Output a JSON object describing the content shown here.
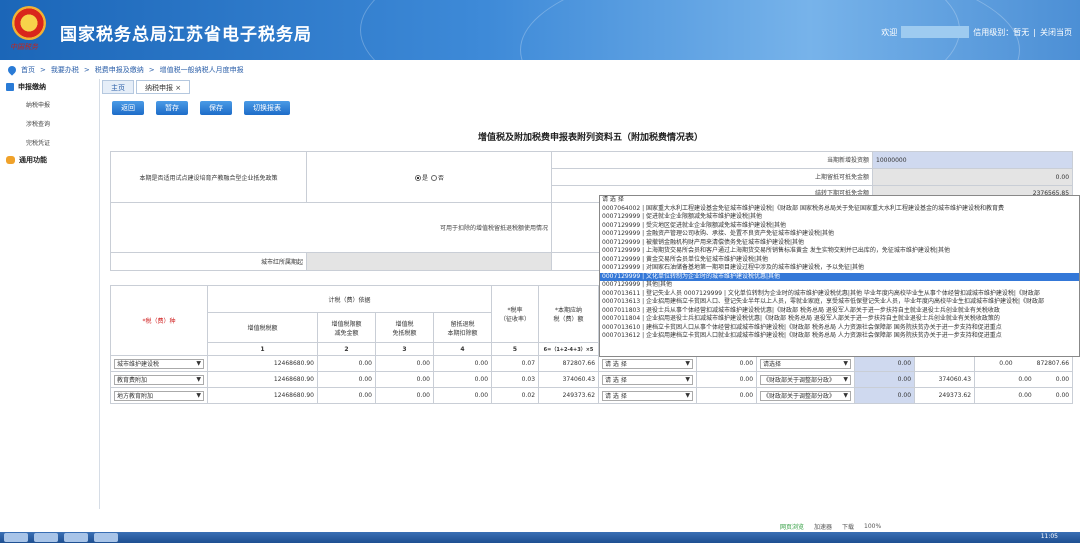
{
  "header": {
    "title": "国家税务总局江苏省电子税务局",
    "emblem_text": "中国税务",
    "welcome": "欢迎",
    "credit": "信用级别：暂无",
    "separator": "|",
    "close": "关闭当页"
  },
  "breadcrumb": [
    "首页",
    ">",
    "我要办税",
    ">",
    "税费申报及缴纳",
    ">",
    "增值税一般纳税人月度申报"
  ],
  "sidebar": {
    "groups": [
      {
        "label": "申报缴纳",
        "items": [
          "纳税申报",
          "涉税查询",
          "完税凭证"
        ]
      },
      {
        "label": "通用功能",
        "items": []
      }
    ]
  },
  "tabs": [
    {
      "label": "主页"
    },
    {
      "label": "纳税申报 ×"
    }
  ],
  "toolbar": {
    "back": "返回",
    "temp_save": "暂存",
    "save": "保存",
    "switch": "切换报表"
  },
  "form_title": "增值税及附加税费申报表附列资料五（附加税费情况表）",
  "top_section": {
    "question": "本期是否适用试点建设培育产教融合型企业抵免政策",
    "yes": "是",
    "no": "否",
    "new_invest_label": "当期新增投资额",
    "new_invest_value": "10000000",
    "prev_deduct_label": "上期留抵可抵免金额",
    "prev_deduct_value": "0.00",
    "carry_label": "结转下期可抵免金额",
    "carry_value": "2376565.85",
    "deduct_label": "可用于扣除的增值税留抵退税额使用情况",
    "bound_label": "城市红所属期起"
  },
  "grid": {
    "tax_type_header": "*税（费）种",
    "basis_header": "计税（费）依据",
    "rate_header": "*税率",
    "rate_sub": "（征收率）",
    "payable_header": "*本期应纳",
    "payable_sub": "税（费）额",
    "cols": [
      "增值税税额",
      "增值税限额",
      "增值税",
      "留抵退税"
    ],
    "cols_sub": [
      "",
      "减免金额",
      "免抵税额",
      "本期扣除额"
    ],
    "nums": [
      "1",
      "2",
      "3",
      "4",
      "5",
      "6=（1+2-4+3）×5"
    ],
    "rows": [
      {
        "type": "城市维护建设税",
        "v1": "12468680.90",
        "v2": "0.00",
        "v3": "0.00",
        "v4": "0.00",
        "rate": "0.07",
        "payable": "872807.66",
        "sel1": "请 选 择",
        "amt1": "0.00",
        "sel2": "请选择",
        "amt2": "0.00",
        "f1": "",
        "f2": "0.00",
        "total": "872807.66"
      },
      {
        "type": "教育费附加",
        "v1": "12468680.90",
        "v2": "0.00",
        "v3": "0.00",
        "v4": "0.00",
        "rate": "0.03",
        "payable": "374060.43",
        "sel1": "请 选 择",
        "amt1": "0.00",
        "sel2": "《财政部关于调整部分政》",
        "amt2": "0.00",
        "f1": "374060.43",
        "f2": "0.00",
        "total": "0.00"
      },
      {
        "type": "地方教育附加",
        "v1": "12468680.90",
        "v2": "0.00",
        "v3": "0.00",
        "v4": "0.00",
        "rate": "0.02",
        "payable": "249373.62",
        "sel1": "请 选 择",
        "amt1": "0.00",
        "sel2": "《财政部关于调整部分政》",
        "amt2": "0.00",
        "f1": "249373.62",
        "f2": "0.00",
        "total": "0.00"
      }
    ]
  },
  "dropdown": {
    "items": [
      "请 选 择",
      "0007064002 | 国家重大水利工程建设基金免征城市维护建设税|《财政部 国家税务总局关于免征国家重大水利工程建设基金的城市维护建设税和教育费",
      "0007129999 | 促进就业企业限额减免城市维护建设税|其他",
      "0007129999 | 受灾地区促进就业企业限额减免城市维护建设税|其他",
      "0007129999 | 金融资产管理公司收购、承接、处置不良资产免征城市维护建设税|其他",
      "0007129999 | 被撤销金融机构财产用来清偿债务免征城市维护建设税|其他",
      "0007129999 | 上海期货交易所会员和客户通过上海期货交易所销售标准黄金 发生实物交割并已出库的，免征城市维护建设税|其他",
      "0007129999 | 黄金交易所会员单位免征城市维护建设税|其他",
      "0007129999 | 对国家石油储备基地第一期项目建设过程中涉及的城市维护建设税，予以免征|其他",
      "0007129999 | 文化单位转制为企业时的城市维护建设税优惠|其他",
      "0007129999 | 其他|其他",
      "0007013611 | 登记失业人员 0007129999 | 文化单位转制为企业时的城市维护建设税优惠|其他 毕业年度内高校毕业生从事个体经营扣减城市维护建设税|《财政部",
      "0007013613 | 企业招用建档立卡贫困人口、登记失业半年以上人员，零就业家庭，享受城市低保登记失业人员，毕业年度内高校毕业生扣减城市维护建设税|《财政部",
      "0007011803 | 退役士兵从事个体经营扣减城市维护建设税优惠|《财政部 税务总局 退役军人部关于进一步扶持自主就业退役士兵创业就业有关税收政",
      "0007011804 | 企业招用退役士兵扣减城市维护建设税优惠|《财政部 税务总局 退役军人部关于进一步扶持自主就业退役士兵创业就业有关税收政策的",
      "0007013610 | 建档立卡贫困人口从事个体经营扣减城市维护建设税|《财政部 税务总局 人力资源社会保障部 国务院扶贫办关于进一步支持和促进重点",
      "0007013612 | 企业招用建档立卡贫困人口就业扣减城市维护建设税|《财政部 税务总局 人力资源社会保障部 国务院扶贫办关于进一步支持和促进重点"
    ],
    "highlighted": 9
  },
  "statusbar": {
    "a": "网页浏览",
    "b": "加速器",
    "c": "下载",
    "zoom": "100%"
  },
  "taskbar": {
    "time": "11:05"
  }
}
